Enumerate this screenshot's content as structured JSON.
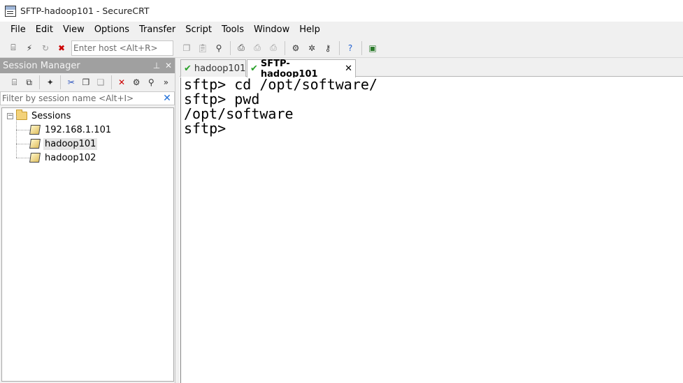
{
  "window": {
    "title": "SFTP-hadoop101 - SecureCRT"
  },
  "menu": [
    "File",
    "Edit",
    "View",
    "Options",
    "Transfer",
    "Script",
    "Tools",
    "Window",
    "Help"
  ],
  "toolbar": {
    "host_placeholder": "Enter host <Alt+R>",
    "icons_left": [
      "connect-icon",
      "quick-connect-icon",
      "reconnect-icon",
      "disconnect-icon"
    ],
    "icons_right": [
      "copy-icon",
      "paste-icon",
      "find-icon",
      "print-icon",
      "print-selection-icon",
      "print-setup-icon",
      "session-options-icon",
      "global-options-icon",
      "key-icon",
      "help-icon",
      "sftp-icon"
    ]
  },
  "session_manager": {
    "title": "Session Manager",
    "pin_glyph": "⊥",
    "close_glyph": "✕",
    "filter_placeholder": "Filter by session name <Alt+I>",
    "tree": {
      "root_label": "Sessions",
      "expander": "−",
      "sessions": [
        "192.168.1.101",
        "hadoop101",
        "hadoop102"
      ],
      "selected": "hadoop101"
    }
  },
  "tabs": [
    {
      "label": "hadoop101",
      "active": false
    },
    {
      "label": "SFTP-hadoop101",
      "active": true
    }
  ],
  "terminal": {
    "lines": [
      "sftp> cd /opt/software/",
      "sftp> pwd",
      "/opt/software",
      "sftp>"
    ]
  }
}
